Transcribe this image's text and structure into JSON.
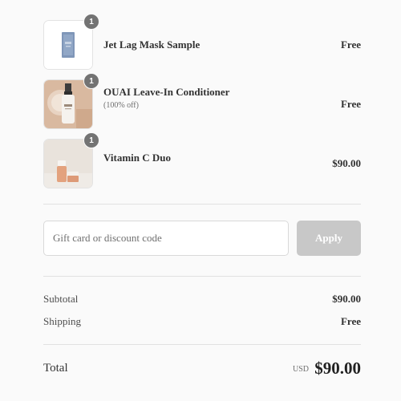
{
  "order_items": [
    {
      "quantity": "1",
      "name": "Jet Lag Mask Sample",
      "note": "",
      "price": "Free",
      "image_icon": "mask-sample-tube-icon"
    },
    {
      "quantity": "1",
      "name": "OUAI Leave-In Conditioner",
      "note": "(100% off)",
      "price": "Free",
      "image_icon": "conditioner-bottle-icon"
    },
    {
      "quantity": "1",
      "name": "Vitamin C Duo",
      "note": "",
      "price": "$90.00",
      "image_icon": "serum-jars-icon"
    }
  ],
  "discount": {
    "placeholder": "Gift card or discount code",
    "value": "",
    "apply_label": "Apply"
  },
  "summary": {
    "subtotal_label": "Subtotal",
    "subtotal_value": "$90.00",
    "shipping_label": "Shipping",
    "shipping_value": "Free"
  },
  "total": {
    "label": "Total",
    "currency": "USD",
    "value": "$90.00"
  },
  "colors": {
    "background": "#fafafa",
    "badge": "#737373",
    "apply_button_disabled": "#c8c8c8",
    "divider": "#e1e1e1"
  }
}
